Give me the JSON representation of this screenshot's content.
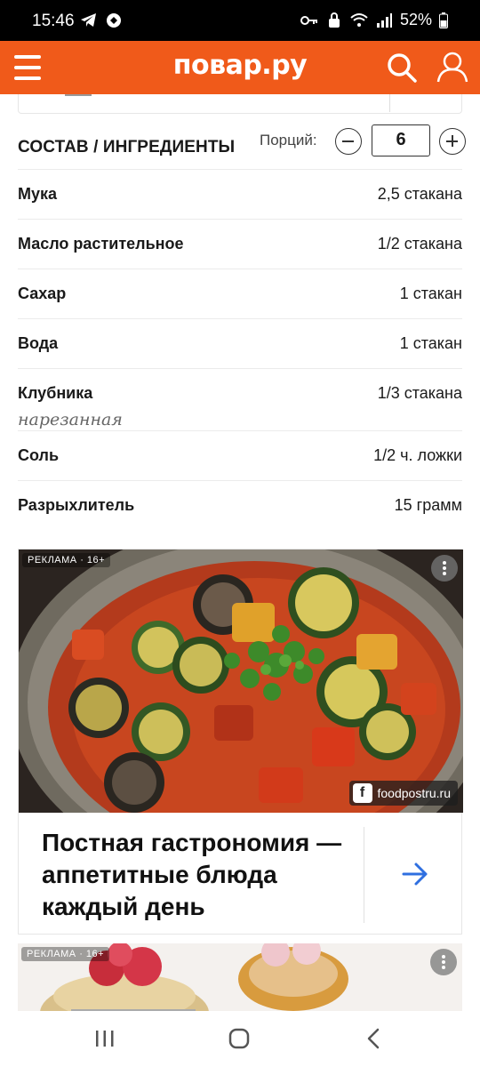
{
  "status_bar": {
    "time": "15:46",
    "battery": "52%",
    "icons": [
      "telegram-icon",
      "app-icon",
      "key-icon",
      "lock-icon",
      "wifi-icon",
      "signal-icon",
      "battery-icon"
    ]
  },
  "header": {
    "logo": "повар.ру",
    "brand_color": "#f05a1a",
    "icons": [
      "menu-icon",
      "search-icon",
      "user-icon"
    ]
  },
  "ingredients": {
    "title": "СОСТАВ / ИНГРЕДИЕНТЫ",
    "portions_label": "Порций:",
    "portions_value": "6",
    "items": [
      {
        "name": "Мука",
        "note": "",
        "qty": "2,5 стакана"
      },
      {
        "name": "Масло растительное",
        "note": "",
        "qty": "1/2 стакана"
      },
      {
        "name": "Сахар",
        "note": "",
        "qty": "1 стакан"
      },
      {
        "name": "Вода",
        "note": "",
        "qty": "1 стакан"
      },
      {
        "name": "Клубника",
        "note": "нарезанная",
        "qty": "1/3 стакана"
      },
      {
        "name": "Соль",
        "note": "",
        "qty": "1/2 ч. ложки"
      },
      {
        "name": "Разрыхлитель",
        "note": "",
        "qty": "15 грамм"
      }
    ]
  },
  "ad1": {
    "label": "РЕКЛАМА · 16+",
    "source": "foodpostru.ru",
    "headline": "Постная гастрономия — аппетитные блюда каждый день",
    "accent": "#2f6fe0"
  },
  "ad2": {
    "label": "РЕКЛАМА · 16+"
  },
  "nav": {
    "icons": [
      "recent-apps-icon",
      "home-icon",
      "back-icon"
    ]
  }
}
